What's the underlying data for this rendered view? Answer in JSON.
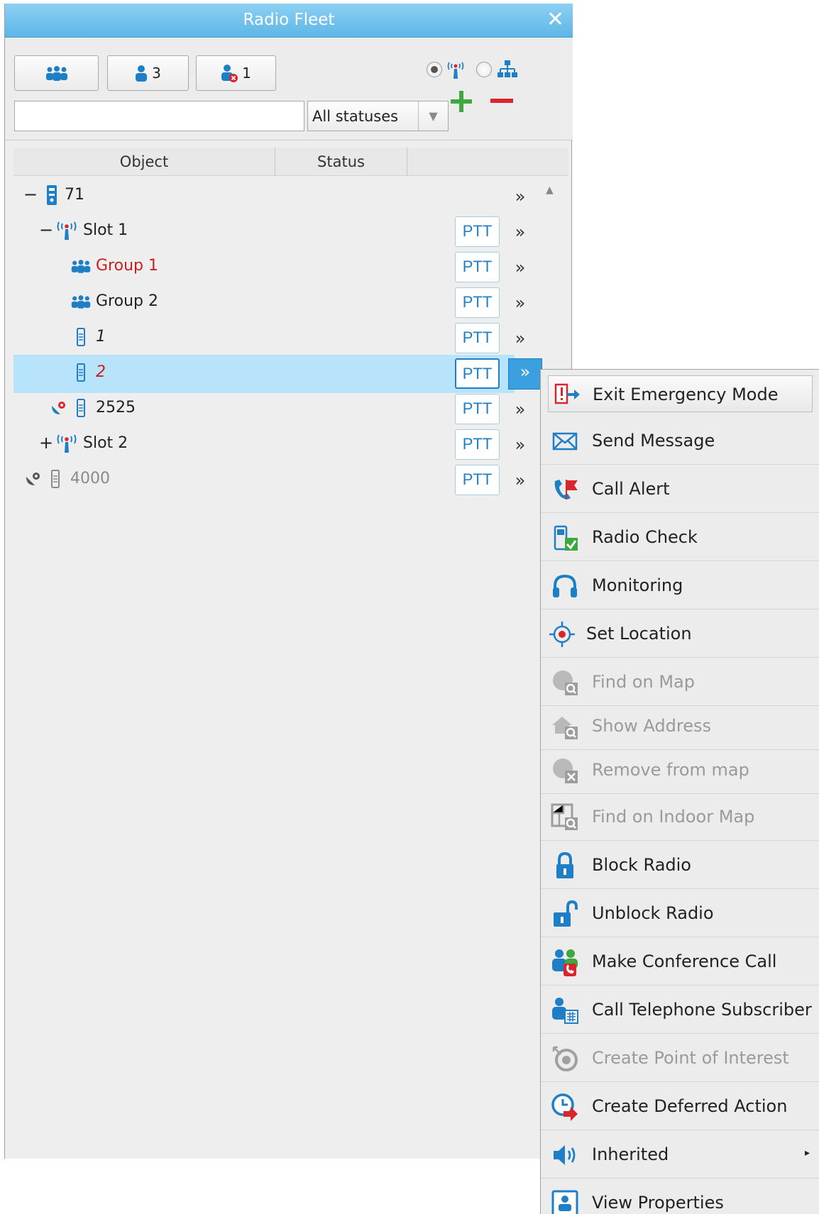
{
  "window": {
    "title": "Radio Fleet",
    "close_glyph": "✕"
  },
  "toolbar": {
    "talkgroups_button_icon": "group-icon",
    "users_count": "3",
    "users_offline_count": "1",
    "view_mode": "radio",
    "search_value": "",
    "status_filter": "All statuses",
    "add_glyph": "+",
    "remove_glyph": "−"
  },
  "columns": {
    "object": "Object",
    "status": "Status"
  },
  "rows": [
    {
      "label": "71",
      "expander": "−"
    },
    {
      "label": "Slot 1",
      "expander": "−",
      "ptt": "PTT"
    },
    {
      "label": "Group 1",
      "ptt": "PTT"
    },
    {
      "label": "Group 2",
      "ptt": "PTT"
    },
    {
      "label": "1",
      "ptt": "PTT"
    },
    {
      "label": "2",
      "ptt": "PTT"
    },
    {
      "label": "2525",
      "ptt": "PTT"
    },
    {
      "label": "Slot 2",
      "expander": "+",
      "ptt": "PTT"
    },
    {
      "label": "4000",
      "ptt": "PTT"
    }
  ],
  "more_glyph": "»",
  "context_menu": [
    {
      "label": "Exit Emergency Mode",
      "icon": "exit-emergency-icon"
    },
    {
      "label": "Send Message",
      "icon": "envelope-icon"
    },
    {
      "label": "Call Alert",
      "icon": "call-alert-icon"
    },
    {
      "label": "Radio Check",
      "icon": "radio-check-icon"
    },
    {
      "label": "Monitoring",
      "icon": "headphones-icon"
    },
    {
      "label": "Set Location",
      "icon": "target-icon"
    },
    {
      "label": "Find on Map",
      "icon": "globe-search-icon",
      "disabled": true
    },
    {
      "label": "Show Address",
      "icon": "house-search-icon",
      "disabled": true
    },
    {
      "label": "Remove from map",
      "icon": "globe-remove-icon",
      "disabled": true
    },
    {
      "label": "Find on Indoor Map",
      "icon": "indoor-map-icon",
      "disabled": true
    },
    {
      "label": "Block Radio",
      "icon": "lock-icon"
    },
    {
      "label": "Unblock Radio",
      "icon": "unlock-icon"
    },
    {
      "label": "Make Conference Call",
      "icon": "conference-call-icon"
    },
    {
      "label": "Call Telephone Subscriber",
      "icon": "telephone-subscriber-icon"
    },
    {
      "label": "Create Point of Interest",
      "icon": "point-of-interest-icon",
      "disabled": true
    },
    {
      "label": "Create Deferred Action",
      "icon": "deferred-action-icon"
    },
    {
      "label": "Inherited",
      "icon": "speaker-icon",
      "submenu_glyph": "▸"
    },
    {
      "label": "View Properties",
      "icon": "properties-icon"
    }
  ],
  "colors": {
    "accent": "#1e7fc6",
    "selected_row": "#b8e4fb",
    "alert_red": "#d9262c",
    "disabled": "#9a9a9a",
    "title_bar": "#6cc0ec"
  }
}
